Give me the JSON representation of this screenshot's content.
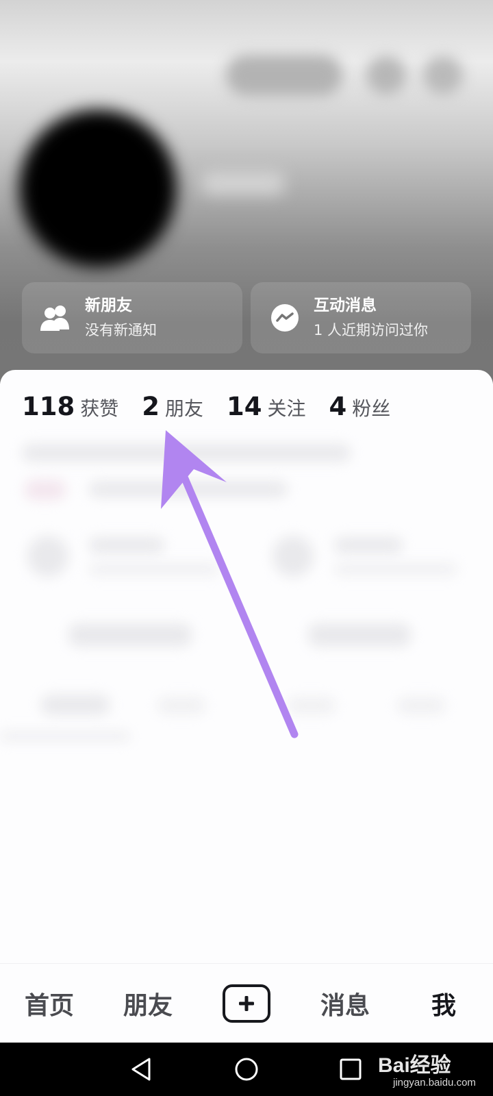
{
  "cards": [
    {
      "title": "新朋友",
      "subtitle": "没有新通知",
      "icon": "people-icon"
    },
    {
      "title": "互动消息",
      "subtitle": "1 人近期访问过你",
      "icon": "messenger-icon"
    }
  ],
  "stats": [
    {
      "value": "118",
      "label": "获赞"
    },
    {
      "value": "2",
      "label": "朋友"
    },
    {
      "value": "14",
      "label": "关注"
    },
    {
      "value": "4",
      "label": "粉丝"
    }
  ],
  "tabs": {
    "home": "首页",
    "friends": "朋友",
    "add_icon": "plus-icon",
    "messages": "消息",
    "me": "我",
    "active": "me"
  },
  "annotation": {
    "color": "#b185f0",
    "icon": "arrow-pointer-icon"
  },
  "system_nav": {
    "back": "back-triangle-icon",
    "home": "home-circle-icon",
    "recent": "recent-square-icon"
  },
  "watermark": {
    "brand": "Bai经验",
    "url": "jingyan.baidu.com"
  },
  "colors": {
    "text_primary": "#15161c",
    "text_secondary": "#55565c",
    "accent": "#b185f0"
  }
}
